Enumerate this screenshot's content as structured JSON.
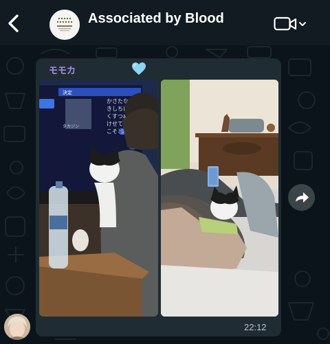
{
  "header": {
    "title": "Associated by Blood",
    "back_icon": "chevron-left-icon",
    "video_icon": "video-camera-icon"
  },
  "message": {
    "sender": "モモカ",
    "sender_color": "#a98bf1",
    "reaction_icon": "light-blue-heart-icon",
    "time": "22:12",
    "forward_icon": "forward-icon"
  },
  "tv_screen": {
    "header_label": "決定",
    "space_key": "スペース",
    "hiragana_columns": [
      "かさたな",
      "きしちに",
      "くすつぬ",
      "けせてね",
      "こそとの"
    ],
    "list_label": "タカジン"
  },
  "colors": {
    "header_bg": "#111b21",
    "chat_bg": "#0b141a",
    "bubble_bg": "#202c33"
  }
}
